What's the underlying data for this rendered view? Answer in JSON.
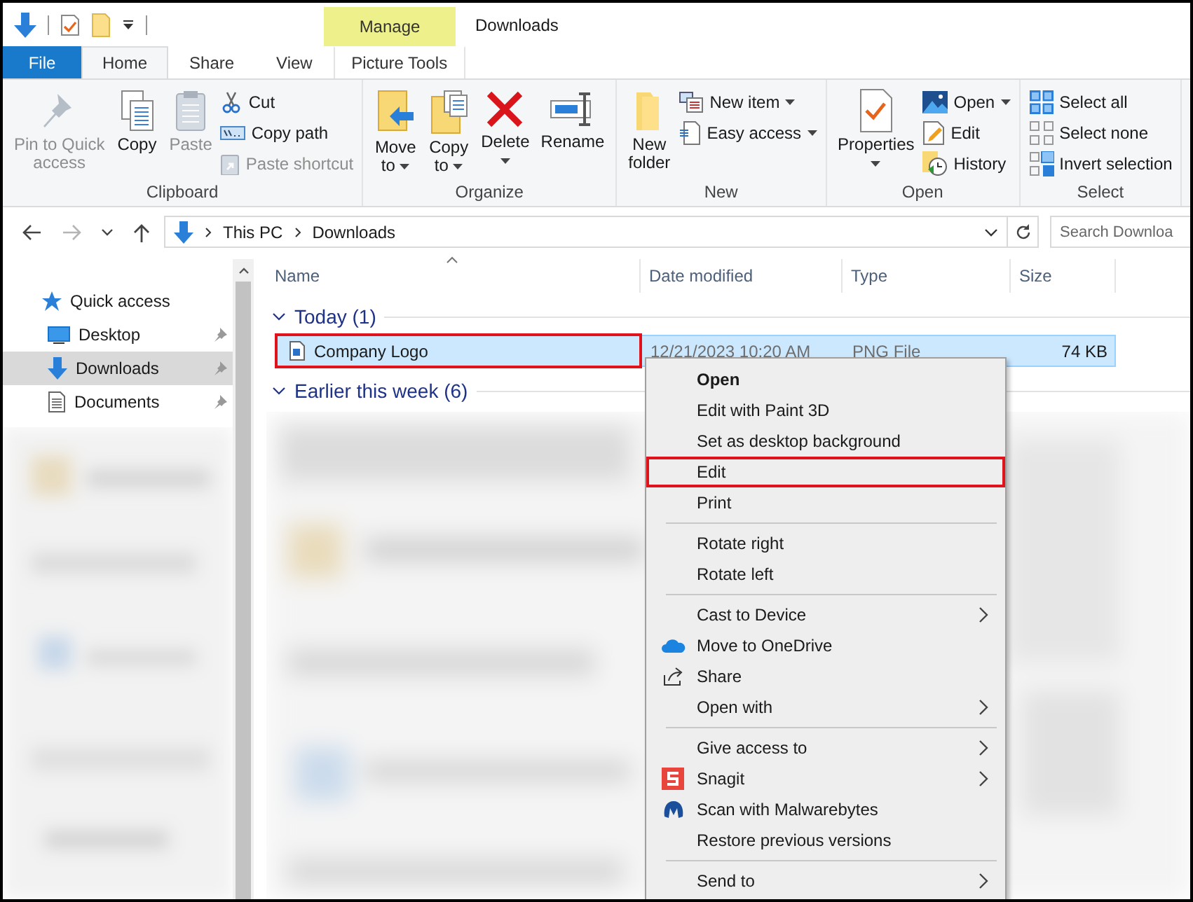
{
  "window": {
    "title": "Downloads"
  },
  "contextual_tab": {
    "header": "Manage",
    "label": "Picture Tools",
    "selected": false
  },
  "tabs": [
    {
      "label": "File",
      "kind": "file",
      "selected": false
    },
    {
      "label": "Home",
      "kind": "tab",
      "selected": true
    },
    {
      "label": "Share",
      "kind": "tab",
      "selected": false
    },
    {
      "label": "View",
      "kind": "tab",
      "selected": false
    }
  ],
  "ribbon_groups": [
    {
      "label": "Clipboard",
      "commands": [
        {
          "lines": [
            "Pin to Quick",
            "access"
          ],
          "kind": "large",
          "disabled": true,
          "dropdown": false
        },
        {
          "lines": [
            "Copy"
          ],
          "kind": "large",
          "disabled": false,
          "dropdown": false
        },
        {
          "lines": [
            "Paste"
          ],
          "kind": "large",
          "disabled": true,
          "dropdown": false
        },
        {
          "lines": [
            "Cut"
          ],
          "kind": "small",
          "disabled": false,
          "dropdown": false
        },
        {
          "lines": [
            "Copy path"
          ],
          "kind": "small",
          "disabled": false,
          "dropdown": false
        },
        {
          "lines": [
            "Paste shortcut"
          ],
          "kind": "small",
          "disabled": true,
          "dropdown": false
        }
      ]
    },
    {
      "label": "Organize",
      "commands": [
        {
          "lines": [
            "Move",
            "to"
          ],
          "kind": "large",
          "disabled": false,
          "dropdown": true
        },
        {
          "lines": [
            "Copy",
            "to"
          ],
          "kind": "large",
          "disabled": false,
          "dropdown": true
        },
        {
          "lines": [
            "Delete"
          ],
          "kind": "large",
          "disabled": false,
          "dropdown": true
        },
        {
          "lines": [
            "Rename"
          ],
          "kind": "large",
          "disabled": false,
          "dropdown": false
        }
      ]
    },
    {
      "label": "New",
      "commands": [
        {
          "lines": [
            "New",
            "folder"
          ],
          "kind": "large",
          "disabled": false,
          "dropdown": false
        },
        {
          "lines": [
            "New item"
          ],
          "kind": "small",
          "disabled": false,
          "dropdown": true
        },
        {
          "lines": [
            "Easy access"
          ],
          "kind": "small",
          "disabled": false,
          "dropdown": true
        }
      ]
    },
    {
      "label": "Open",
      "commands": [
        {
          "lines": [
            "Properties"
          ],
          "kind": "large",
          "disabled": false,
          "dropdown": true
        },
        {
          "lines": [
            "Open"
          ],
          "kind": "small",
          "disabled": false,
          "dropdown": true
        },
        {
          "lines": [
            "Edit"
          ],
          "kind": "small",
          "disabled": false,
          "dropdown": false
        },
        {
          "lines": [
            "History"
          ],
          "kind": "small",
          "disabled": false,
          "dropdown": false
        }
      ]
    },
    {
      "label": "Select",
      "commands": [
        {
          "lines": [
            "Select all"
          ],
          "kind": "small",
          "disabled": false,
          "dropdown": false
        },
        {
          "lines": [
            "Select none"
          ],
          "kind": "small",
          "disabled": false,
          "dropdown": false
        },
        {
          "lines": [
            "Invert selection"
          ],
          "kind": "small",
          "disabled": false,
          "dropdown": false
        }
      ]
    }
  ],
  "navigation": {
    "back_disabled": false,
    "forward_disabled": true
  },
  "address_bar": {
    "path": [
      "This PC",
      "Downloads"
    ]
  },
  "search": {
    "placeholder": "Search Downloa"
  },
  "sidebar": {
    "items": [
      {
        "label": "Quick access",
        "kind": "header",
        "selected": false,
        "pinned": false
      },
      {
        "label": "Desktop",
        "kind": "item",
        "selected": false,
        "pinned": true
      },
      {
        "label": "Downloads",
        "kind": "item",
        "selected": true,
        "pinned": true
      },
      {
        "label": "Documents",
        "kind": "item",
        "selected": false,
        "pinned": true
      }
    ]
  },
  "file_list": {
    "columns": [
      "Name",
      "Date modified",
      "Type",
      "Size"
    ],
    "groups": [
      {
        "label": "Today (1)",
        "expanded": true,
        "files": [
          {
            "name": "Company Logo",
            "date_modified": "12/21/2023 10:20 AM",
            "type": "PNG File",
            "size": "74 KB",
            "selected": true,
            "highlighted": true
          }
        ]
      },
      {
        "label": "Earlier this week (6)",
        "expanded": true
      }
    ]
  },
  "context_menu": {
    "items": [
      {
        "kind": "item",
        "label": "Open",
        "default": true,
        "submenu": false,
        "highlighted": false
      },
      {
        "kind": "item",
        "label": "Edit with Paint 3D",
        "default": false,
        "submenu": false,
        "highlighted": false
      },
      {
        "kind": "item",
        "label": "Set as desktop background",
        "default": false,
        "submenu": false,
        "highlighted": false
      },
      {
        "kind": "item",
        "label": "Edit",
        "default": false,
        "submenu": false,
        "highlighted": true
      },
      {
        "kind": "item",
        "label": "Print",
        "default": false,
        "submenu": false,
        "highlighted": false
      },
      {
        "kind": "separator"
      },
      {
        "kind": "item",
        "label": "Rotate right",
        "default": false,
        "submenu": false,
        "highlighted": false
      },
      {
        "kind": "item",
        "label": "Rotate left",
        "default": false,
        "submenu": false,
        "highlighted": false
      },
      {
        "kind": "separator"
      },
      {
        "kind": "item",
        "label": "Cast to Device",
        "default": false,
        "submenu": true,
        "highlighted": false
      },
      {
        "kind": "item",
        "label": "Move to OneDrive",
        "default": false,
        "submenu": false,
        "highlighted": false
      },
      {
        "kind": "item",
        "label": "Share",
        "default": false,
        "submenu": false,
        "highlighted": false
      },
      {
        "kind": "item",
        "label": "Open with",
        "default": false,
        "submenu": true,
        "highlighted": false
      },
      {
        "kind": "separator"
      },
      {
        "kind": "item",
        "label": "Give access to",
        "default": false,
        "submenu": true,
        "highlighted": false
      },
      {
        "kind": "item",
        "label": "Snagit",
        "default": false,
        "submenu": true,
        "highlighted": false
      },
      {
        "kind": "item",
        "label": "Scan with Malwarebytes",
        "default": false,
        "submenu": false,
        "highlighted": false
      },
      {
        "kind": "item",
        "label": "Restore previous versions",
        "default": false,
        "submenu": false,
        "highlighted": false
      },
      {
        "kind": "separator"
      },
      {
        "kind": "item",
        "label": "Send to",
        "default": false,
        "submenu": true,
        "highlighted": false
      }
    ]
  }
}
